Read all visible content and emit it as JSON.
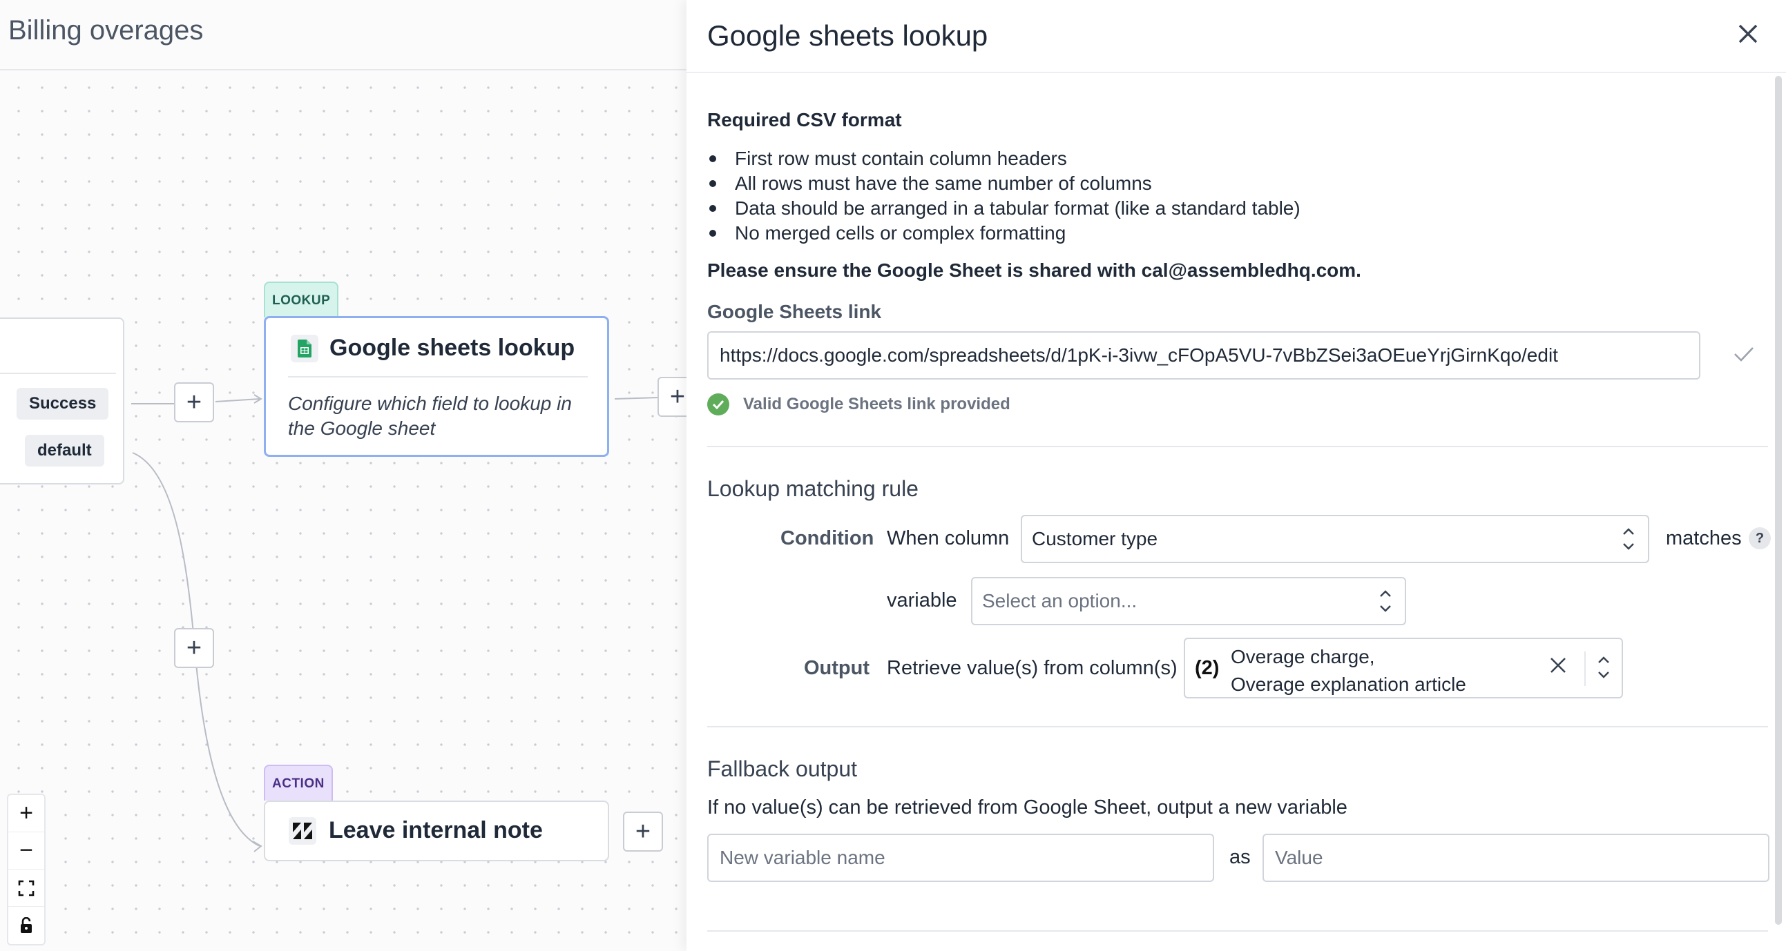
{
  "canvas": {
    "title": "Billing overages",
    "branch_pills": [
      "Success",
      "default"
    ],
    "lookup_node": {
      "tag": "LOOKUP",
      "title": "Google sheets lookup",
      "icon": "google-sheets-icon",
      "description": "Configure which field to lookup in the Google sheet"
    },
    "action_node": {
      "tag": "ACTION",
      "title": "Leave internal note",
      "icon": "zendesk-icon"
    },
    "plus_symbol": "+",
    "zoom": {
      "in": "+",
      "out": "−"
    }
  },
  "panel": {
    "title": "Google sheets lookup",
    "csv_heading": "Required CSV format",
    "csv_rules": [
      "First row must contain column headers",
      "All rows must have the same number of columns",
      "Data should be arranged in a tabular format (like a standard table)",
      "No merged cells or complex formatting"
    ],
    "share_notice": "Please ensure the Google Sheet is shared with cal@assembledhq.com.",
    "link_label": "Google Sheets link",
    "link_value": "https://docs.google.com/spreadsheets/d/1pK-i-3ivw_cFOpA5VU-7vBbZSei3aOEueYrjGirnKqo/edit",
    "link_status": "Valid Google Sheets link provided",
    "matching": {
      "heading": "Lookup matching rule",
      "condition_label": "Condition",
      "when_column": "When column",
      "column_value": "Customer type",
      "matches": "matches",
      "help": "?",
      "variable_label": "variable",
      "variable_placeholder": "Select an option...",
      "output_label": "Output",
      "retrieve_text": "Retrieve value(s) from column(s)",
      "output_count": "(2)",
      "output_values": [
        "Overage charge,",
        "Overage explanation article"
      ]
    },
    "fallback": {
      "heading": "Fallback output",
      "description": "If no value(s) can be retrieved from Google Sheet, output a new variable",
      "name_placeholder": "New variable name",
      "as": "as",
      "value_placeholder": "Value"
    }
  },
  "colors": {
    "lookup_tag_bg": "#d6f3ec",
    "action_tag_bg": "#e9e1fb",
    "selected_node_border": "#8fb0f0",
    "valid_green": "#5fad5a"
  }
}
